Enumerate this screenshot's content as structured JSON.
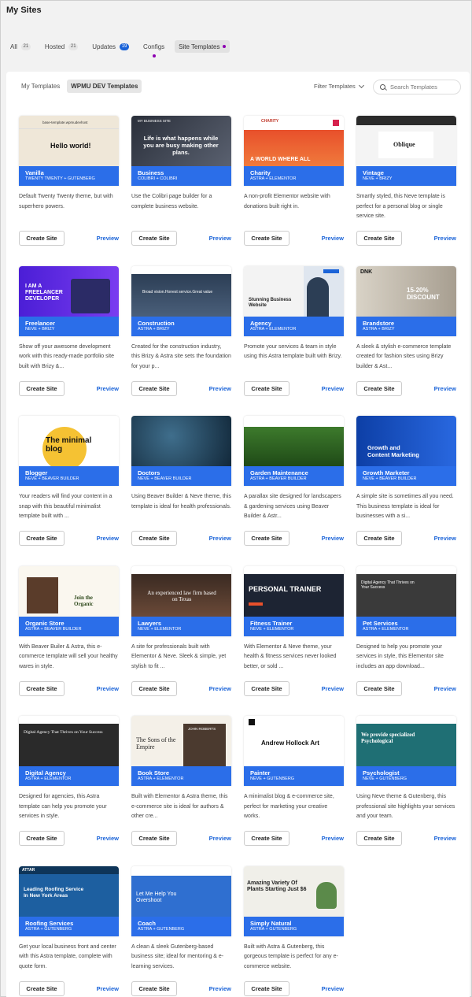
{
  "header": {
    "title": "My Sites"
  },
  "tabs": [
    {
      "label": "All",
      "count": "21"
    },
    {
      "label": "Hosted",
      "count": "21"
    },
    {
      "label": "Updates",
      "count": "19"
    },
    {
      "label": "Configs"
    },
    {
      "label": "Site Templates"
    }
  ],
  "subtabs": [
    "My Templates",
    "WPMU DEV Templates"
  ],
  "filter": {
    "label": "Filter Templates"
  },
  "search": {
    "placeholder": "Search Templates"
  },
  "actions": {
    "create": "Create Site",
    "preview": "Preview"
  },
  "colors": {
    "accent": "#2b6ee9",
    "link": "#1a63d8",
    "dot": "#8d00b1"
  },
  "templates": [
    {
      "name": "Vanilla",
      "stack": "TWENTY TWENTY + GUTENBERG",
      "desc": "Default Twenty Twenty theme, but with superhero powers.",
      "thumb_title": "Hello world!",
      "thumb_sub": "base-template.wpmudevhost"
    },
    {
      "name": "Business",
      "stack": "COLIBRI + COLIBRI",
      "desc": "Use the Colibri page builder for a complete business website.",
      "thumb_title": "Life is what happens while you are busy making other plans.",
      "thumb_sub": "MY BUSINESS SITE"
    },
    {
      "name": "Charity",
      "stack": "ASTRA + ELEMENTOR",
      "desc": "A non-profit Elementor website with donations built right in.",
      "thumb_title": "A WORLD WHERE ALL",
      "thumb_sub": "CHARITY"
    },
    {
      "name": "Vintage",
      "stack": "NEVE + BRIZY",
      "desc": "Smartly styled, this Neve template is perfect for a personal blog or single service site.",
      "thumb_title": "Oblique",
      "thumb_sub": ""
    },
    {
      "name": "Freelancer",
      "stack": "NEVE + BRIZY",
      "desc": "Show off your awesome development work with this ready-made portfolio site built with Brizy &...",
      "thumb_title": "I AM A FREELANCER DEVELOPER",
      "thumb_sub": ""
    },
    {
      "name": "Construction",
      "stack": "ASTRA + BRIZY",
      "desc": "Created for the construction industry, this Brizy & Astra site sets the foundation for your p...",
      "thumb_title": "Broad vision.Honest service.Great value",
      "thumb_sub": ""
    },
    {
      "name": "Agency",
      "stack": "ASTRA + ELEMENTOR",
      "desc": "Promote your services & team in style using this Astra template built with Brizy.",
      "thumb_title": "Stunning Business Website",
      "thumb_sub": ""
    },
    {
      "name": "Brandstore",
      "stack": "ASTRA + BRIZY",
      "desc": "A sleek & stylish e-commerce template created for fashion sites using Brizy builder & Ast...",
      "thumb_title": "15-20% DISCOUNT",
      "thumb_sub": "DNK"
    },
    {
      "name": "Blogger",
      "stack": "NEVE + BEAVER BUILDER",
      "desc": "Your readers will find your content in a snap with this beautiful minimalist template built with ...",
      "thumb_title": "The minimal blog",
      "thumb_sub": ""
    },
    {
      "name": "Doctors",
      "stack": "NEVE + BEAVER BUILDER",
      "desc": "Using Beaver Builder & Neve theme, this template is ideal for health professionals.",
      "thumb_title": "",
      "thumb_sub": ""
    },
    {
      "name": "Garden Maintenance",
      "stack": "ASTRA + BEAVER BUILDER",
      "desc": "A parallax site designed for landscapers & gardening services using Beaver Builder & Astr...",
      "thumb_title": "",
      "thumb_sub": ""
    },
    {
      "name": "Growth Marketer",
      "stack": "NEVE + BEAVER BUILDER",
      "desc": "A simple site is sometimes all you need. This business template is ideal for businesses with a si...",
      "thumb_title": "Growth and Content Marketing",
      "thumb_sub": ""
    },
    {
      "name": "Organic Store",
      "stack": "ASTRA + BEAVER BUILDER",
      "desc": "With Beaver Builer & Astra, this e-commerce template will sell your healthy wares in style.",
      "thumb_title": "Join the Organic",
      "thumb_sub": ""
    },
    {
      "name": "Lawyers",
      "stack": "NEVE + ELEMENTOR",
      "desc": "A site for professionals built with Elementor & Neve. Sleek & simple, yet stylish to fit ...",
      "thumb_title": "An experienced law firm based on Texas",
      "thumb_sub": ""
    },
    {
      "name": "Fitness Trainer",
      "stack": "NEVE + ELEMENTOR",
      "desc": "With Elementor & Neve theme, your health & fitness services never looked better, or sold ...",
      "thumb_title": "PERSONAL TRAINER",
      "thumb_sub": ""
    },
    {
      "name": "Pet Services",
      "stack": "ASTRA + ELEMENTOR",
      "desc": "Designed to help you promote your services in style, this Elementor site includes an app download...",
      "thumb_title": "Digital Agency That Thrives on Your Success",
      "thumb_sub": ""
    },
    {
      "name": "Digital Agency",
      "stack": "ASTRA + ELEMENTOR",
      "desc": "Designed for agencies, this Astra template can help you promote your services in style.",
      "thumb_title": "Digital Agency That Thrives on Your Success",
      "thumb_sub": ""
    },
    {
      "name": "Book Store",
      "stack": "ASTRA + ELEMENTOR",
      "desc": "Built with Elementor & Astra theme, this e-commerce site is ideal for authors & other cre...",
      "thumb_title": "The Sons of the Empire",
      "thumb_sub": "JOHN ROBERTS"
    },
    {
      "name": "Painter",
      "stack": "NEVE + GUTENBERG",
      "desc": "A minimalist blog & e-commerce site, perfect for marketing your creative works.",
      "thumb_title": "Andrew Hollock Art",
      "thumb_sub": ""
    },
    {
      "name": "Psychologist",
      "stack": "NEVE + GUTENBERG",
      "desc": "Using Neve theme & Gutenberg, this professional site highlights your services and your team.",
      "thumb_title": "We provide specialized Psychological",
      "thumb_sub": ""
    },
    {
      "name": "Roofing Services",
      "stack": "ASTRA + GUTENBERG",
      "desc": "Get your local business front and center with this Astra template, complete with quote form.",
      "thumb_title": "Leading Roofing Service In New York Areas",
      "thumb_sub": "ATTAR"
    },
    {
      "name": "Coach",
      "stack": "ASTRA + GUTENBERG",
      "desc": "A clean & sleek Gutenberg-based business site; ideal for mentoring & e-learning services.",
      "thumb_title": "Let Me Help You Overshoot",
      "thumb_sub": ""
    },
    {
      "name": "Simply Natural",
      "stack": "ASTRA + GUTENBERG",
      "desc": "Built with Astra & Gutenberg, this gorgeous template is perfect for any e-commerce website.",
      "thumb_title": "Amazing Variety Of Plants Starting Just $6",
      "thumb_sub": ""
    }
  ]
}
